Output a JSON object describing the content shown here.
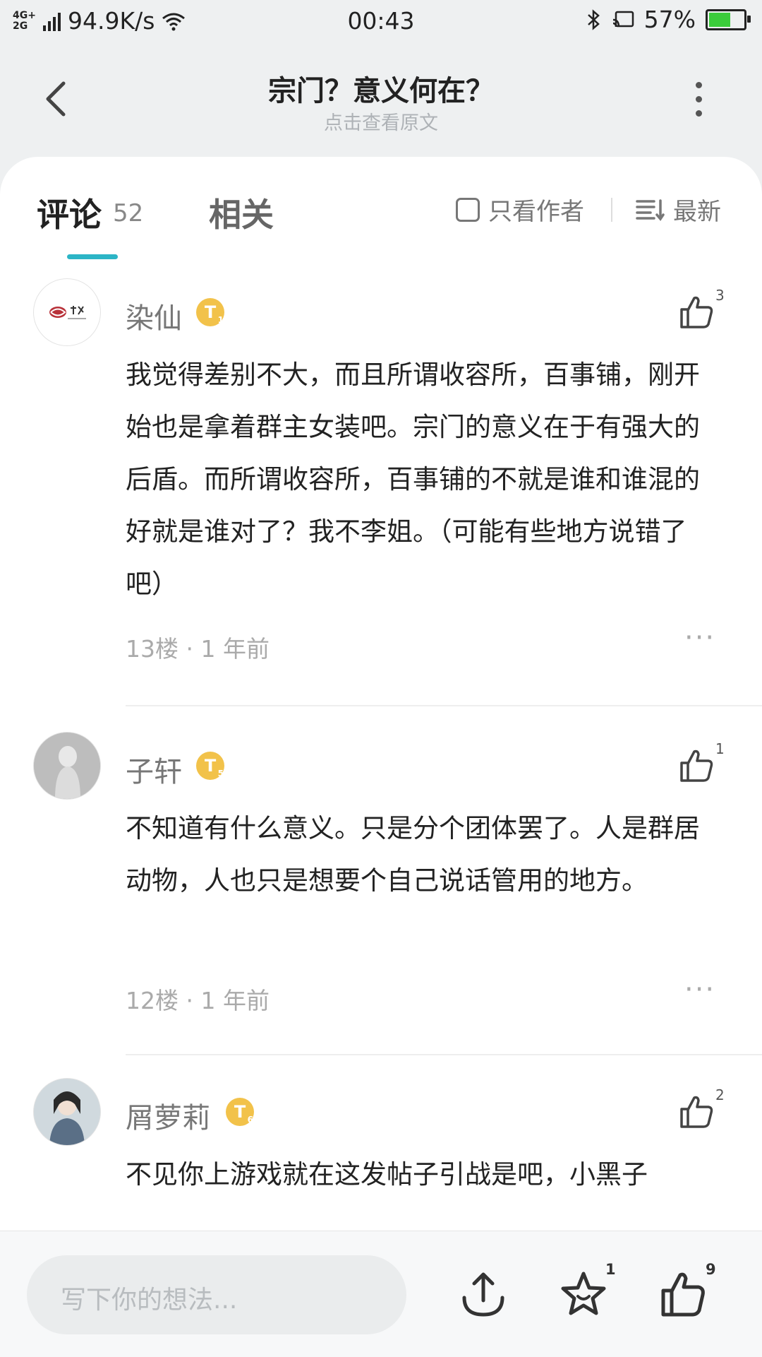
{
  "status_bar": {
    "network": "4G+ 2G",
    "speed": "94.9K/s",
    "time": "00:43",
    "battery": "57%",
    "battery_level": 0.57,
    "icons": [
      "signal-icon",
      "wifi-icon",
      "bluetooth-icon",
      "cast-icon",
      "battery-icon"
    ]
  },
  "header": {
    "title": "宗门？意义何在？",
    "subtitle": "点击查看原文"
  },
  "tabs": {
    "comments_label": "评论",
    "comments_count": "52",
    "related_label": "相关",
    "author_only_label": "只看作者",
    "sort_label": "最新"
  },
  "comments": [
    {
      "username": "染仙",
      "level": "T",
      "level_num": "1",
      "likes": "3",
      "text": "我觉得差别不大，而且所谓收容所，百事铺，刚开始也是拿着群主女装吧。宗门的意义在于有强大的后盾。而所谓收容所，百事铺的不就是谁和谁混的好就是谁对了？我不李姐。（可能有些地方说错了吧）",
      "meta": "13楼 · 1 年前"
    },
    {
      "username": "子轩",
      "level": "T",
      "level_num": "5",
      "likes": "1",
      "text": "不知道有什么意义。只是分个团体罢了。人是群居动物，人也只是想要个自己说话管用的地方。",
      "meta": "12楼 · 1 年前"
    },
    {
      "username": "屑萝莉",
      "level": "T",
      "level_num": "6",
      "likes": "2",
      "text": "不见你上游戏就在这发帖子引战是吧，小黑子",
      "meta": ""
    }
  ],
  "bottom_bar": {
    "placeholder": "写下你的想法...",
    "star_count": "1",
    "like_count": "9"
  },
  "colors": {
    "accent": "#2cb5c6",
    "badge": "#f2c24a",
    "battery_fill": "#3bcc3b"
  }
}
